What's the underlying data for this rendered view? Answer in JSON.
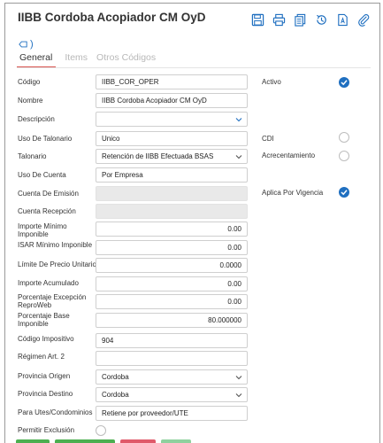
{
  "window": {
    "title": "IIBB Cordoba Acopiador CM OyD"
  },
  "toolbar": {
    "icons": [
      "save-icon",
      "print-icon",
      "copy-icon",
      "history-icon",
      "document-icon",
      "attach-icon"
    ]
  },
  "tag": {
    "label": ")"
  },
  "tabs": [
    {
      "label": "General",
      "active": true
    },
    {
      "label": "Items",
      "active": false
    },
    {
      "label": "Otros Códigos",
      "active": false
    }
  ],
  "form": {
    "codigo": {
      "label": "Código",
      "value": "IIBB_COR_OPER"
    },
    "nombre": {
      "label": "Nombre",
      "value": "IIBB Cordoba Acopiador CM OyD"
    },
    "descripcion": {
      "label": "Descripción",
      "value": ""
    },
    "uso_talonario": {
      "label": "Uso De Talonario",
      "value": "Unico"
    },
    "talonario": {
      "label": "Talonario",
      "value": "Retención de IIBB Efectuada BSAS"
    },
    "uso_cuenta": {
      "label": "Uso De Cuenta",
      "value": "Por Empresa"
    },
    "cuenta_emision": {
      "label": "Cuenta De Emisión",
      "value": ""
    },
    "cuenta_recepcion": {
      "label": "Cuenta Recepción",
      "value": ""
    },
    "importe_minimo": {
      "label": "Importe Mínimo Imponible",
      "value": "0.00"
    },
    "isar_minimo": {
      "label": "ISAR Mínimo Imponible",
      "value": "0.00"
    },
    "limite_precio": {
      "label": "Límite De Precio Unitario",
      "value": "0.0000"
    },
    "importe_acumulado": {
      "label": "Importe Acumulado",
      "value": "0.00"
    },
    "porcentaje_excepcion": {
      "label": "Porcentaje Excepción ReproWeb",
      "value": "0.00"
    },
    "porcentaje_base": {
      "label": "Porcentaje Base Imponible",
      "value": "80.000000"
    },
    "codigo_impositivo": {
      "label": "Código Impositivo",
      "value": "904"
    },
    "regimen": {
      "label": "Régimen Art. 2",
      "value": ""
    },
    "provincia_origen": {
      "label": "Provincia Origen",
      "value": "Cordoba"
    },
    "provincia_destino": {
      "label": "Provincia Destino",
      "value": "Cordoba"
    },
    "para_utes": {
      "label": "Para Utes/Condominios",
      "value": "Retiene por proveedor/UTE"
    },
    "permitir_exclusion": {
      "label": "Permitir Exclusión",
      "checked": false
    }
  },
  "right": {
    "activo": {
      "label": "Activo",
      "checked": true
    },
    "cdi": {
      "label": "CDI",
      "checked": false
    },
    "acrecentamiento": {
      "label": "Acrecentamiento",
      "checked": false
    },
    "aplica_vigencia": {
      "label": "Aplica Por Vigencia",
      "checked": true
    }
  },
  "colors": {
    "accent": "#1f6fc0",
    "tab_underline": "#d9534f"
  }
}
